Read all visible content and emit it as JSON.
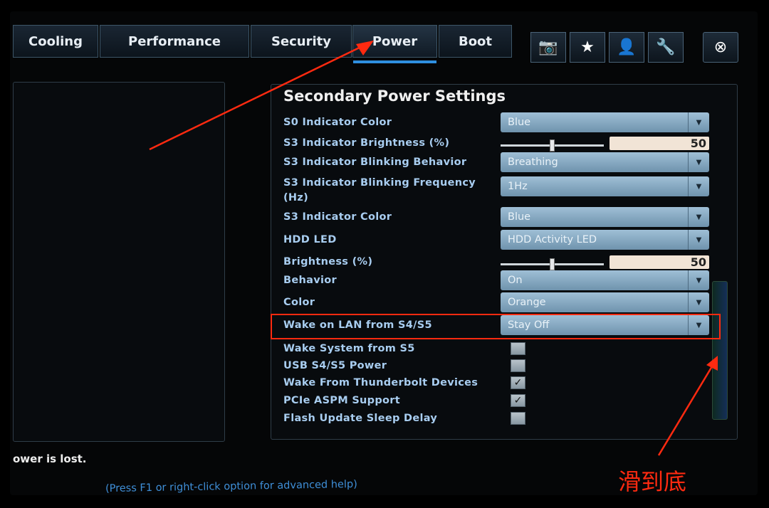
{
  "tabs": [
    {
      "label": "Cooling"
    },
    {
      "label": "Performance"
    },
    {
      "label": "Security"
    },
    {
      "label": "Power",
      "active": true
    },
    {
      "label": "Boot"
    }
  ],
  "toolbar_icons": [
    "camera-icon",
    "star-icon",
    "user-icon",
    "wrench-icon",
    "close-icon"
  ],
  "panel": {
    "title": "Secondary Power Settings",
    "rows": [
      {
        "label": "S0 Indicator Color",
        "type": "dropdown",
        "value": "Blue"
      },
      {
        "label": "S3 Indicator Brightness (%)",
        "type": "slider",
        "value": "50"
      },
      {
        "label": "S3 Indicator Blinking Behavior",
        "type": "dropdown",
        "value": "Breathing"
      },
      {
        "label": "S3 Indicator Blinking Frequency (Hz)",
        "type": "dropdown",
        "value": "1Hz"
      },
      {
        "label": "S3 Indicator Color",
        "type": "dropdown",
        "value": "Blue"
      },
      {
        "label": "HDD LED",
        "type": "dropdown",
        "value": "HDD Activity LED"
      },
      {
        "label": "Brightness (%)",
        "type": "slider",
        "value": "50"
      },
      {
        "label": "Behavior",
        "type": "dropdown",
        "value": "On"
      },
      {
        "label": "Color",
        "type": "dropdown",
        "value": "Orange"
      },
      {
        "label": "Wake on LAN from S4/S5",
        "type": "dropdown",
        "value": "Stay Off",
        "highlighted": true
      },
      {
        "label": "Wake System from S5",
        "type": "checkbox",
        "checked": false
      },
      {
        "label": "USB S4/S5 Power",
        "type": "checkbox",
        "checked": false
      },
      {
        "label": "Wake From Thunderbolt Devices",
        "type": "checkbox",
        "checked": true
      },
      {
        "label": "PCIe ASPM Support",
        "type": "checkbox",
        "checked": true
      },
      {
        "label": "Flash Update Sleep Delay",
        "type": "checkbox",
        "checked": false
      }
    ]
  },
  "status": "ower is lost.",
  "help": "(Press F1 or right-click option for advanced help)",
  "annotation": "滑到底",
  "colors": {
    "annotation": "#ff2a10",
    "label": "#a8cdf0",
    "accent": "#2f8fe0"
  }
}
